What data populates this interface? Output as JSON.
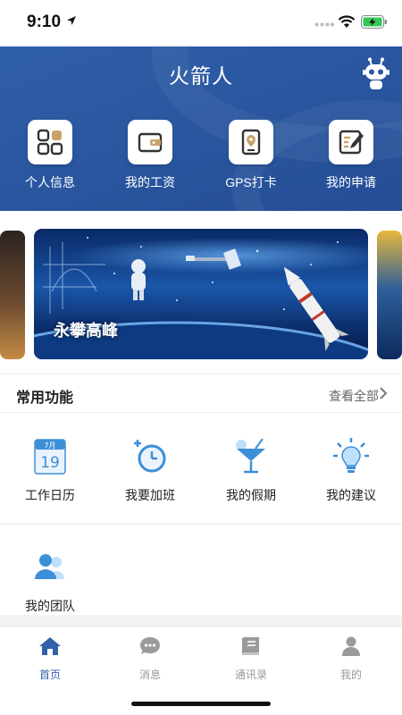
{
  "status_bar": {
    "time": "9:10"
  },
  "header": {
    "title": "火箭人"
  },
  "quick_actions": [
    {
      "label": "个人信息",
      "icon": "grid-apps-icon"
    },
    {
      "label": "我的工资",
      "icon": "wallet-icon"
    },
    {
      "label": "GPS打卡",
      "icon": "gps-location-icon"
    },
    {
      "label": "我的申请",
      "icon": "edit-form-icon"
    }
  ],
  "banner": {
    "caption": "永攀高峰"
  },
  "common_functions": {
    "title": "常用功能",
    "view_all": "查看全部",
    "items": [
      {
        "label": "工作日历",
        "icon": "calendar-icon",
        "calendar_month": "7月",
        "calendar_day": "19"
      },
      {
        "label": "我要加班",
        "icon": "overtime-clock-icon"
      },
      {
        "label": "我的假期",
        "icon": "cocktail-icon"
      },
      {
        "label": "我的建议",
        "icon": "lightbulb-icon"
      },
      {
        "label": "我的团队",
        "icon": "team-icon"
      }
    ]
  },
  "tab_bar": {
    "active": "首页",
    "tabs": [
      {
        "label": "首页",
        "icon": "home-icon"
      },
      {
        "label": "消息",
        "icon": "message-icon"
      },
      {
        "label": "通讯录",
        "icon": "contacts-book-icon"
      },
      {
        "label": "我的",
        "icon": "profile-icon"
      }
    ]
  },
  "colors": {
    "brand_blue": "#2a57a0",
    "tab_active": "#3261a8",
    "icon_blue": "#3d8fd8"
  }
}
